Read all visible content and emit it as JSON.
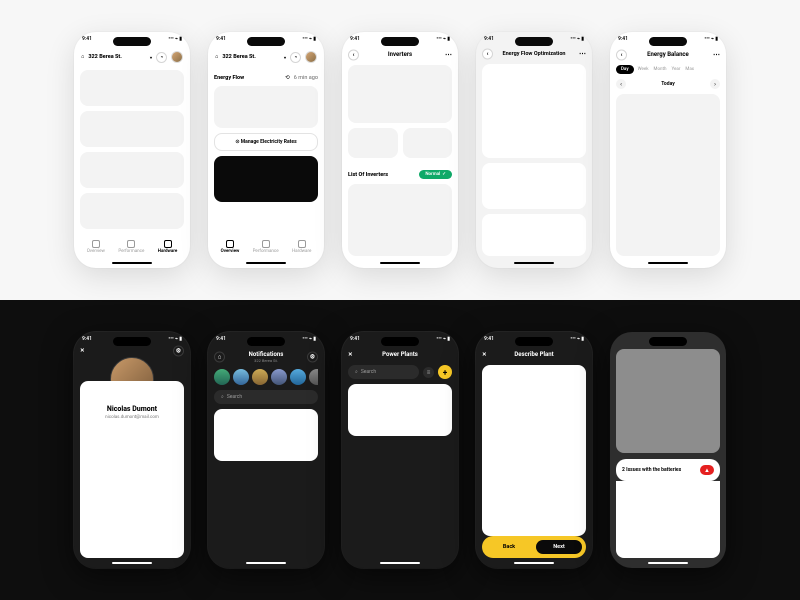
{
  "status_time": "9:41",
  "address": "322 Berea St.",
  "tabs": {
    "overview": "Overview",
    "performance": "Performance",
    "hardware": "Hardware"
  },
  "energy_flow_label": "Energy Flow",
  "energy_flow_time": "6 min ago",
  "manage_rates": "Manage Electricity Rates",
  "inverters_title": "Inverters",
  "inverters_list": "List Of Inverters",
  "status_normal": "Normal",
  "efo_title": "Energy Flow Optimization",
  "balance_title": "Energy Balance",
  "seg": {
    "day": "Day",
    "week": "Week",
    "month": "Month",
    "year": "Year",
    "max": "Max"
  },
  "today": "Today",
  "profile": {
    "name": "Nicolas Dumont",
    "email": "nicolas.dumont@mail.com"
  },
  "notifications_title": "Notifications",
  "search_ph": "Search",
  "power_plants_title": "Power Plants",
  "describe_title": "Describe Plant",
  "back": "Back",
  "next": "Next",
  "alert_text": "2 Issues with the batteries"
}
